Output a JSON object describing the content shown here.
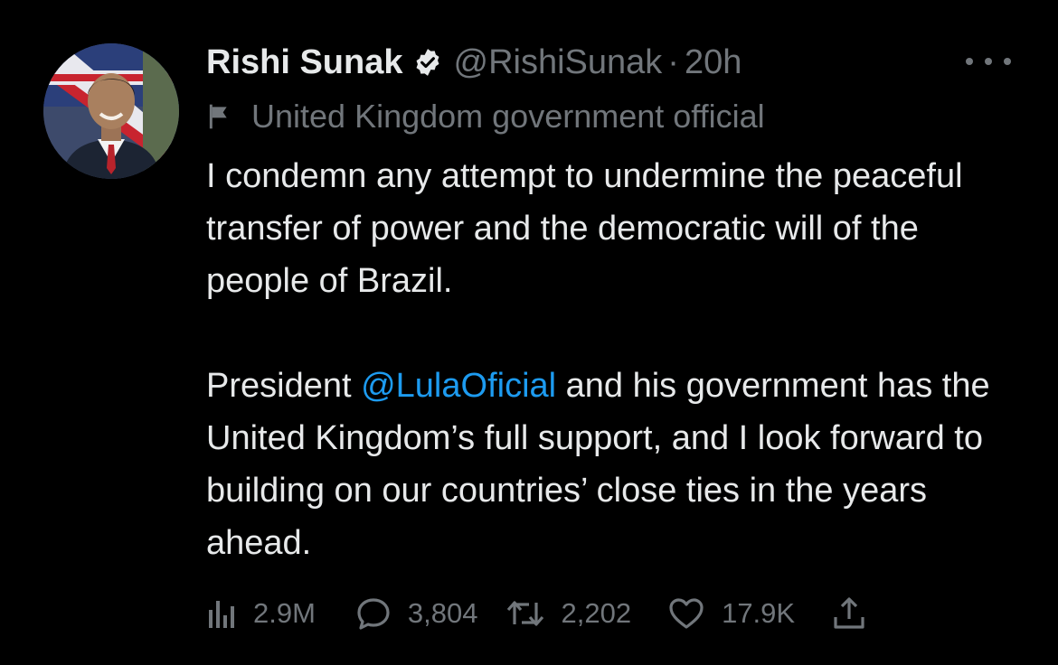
{
  "author": {
    "name": "Rishi Sunak",
    "handle": "@RishiSunak",
    "separator": "·",
    "time": "20h",
    "label": "United Kingdom government official"
  },
  "tweet": {
    "para1": "I condemn any attempt to undermine the peaceful transfer of power and the democratic will of the people of Brazil.",
    "para2_before": "President ",
    "mention": "@LulaOficial",
    "para2_after": " and his government has the United Kingdom’s full support, and I look forward to building on our countries’ close ties in the years ahead."
  },
  "actions": {
    "views": "2.9M",
    "replies": "3,804",
    "retweets": "2,202",
    "likes": "17.9K"
  },
  "icons": {
    "verified": "verified-badge-icon",
    "label": "flag-icon",
    "more": "more-options-icon",
    "views": "analytics-icon",
    "replies": "reply-icon",
    "retweets": "retweet-icon",
    "likes": "heart-icon",
    "share": "share-icon"
  },
  "colors": {
    "background": "#000000",
    "text": "#e7e9ea",
    "secondary": "#71767b",
    "link": "#1d9bf0"
  }
}
